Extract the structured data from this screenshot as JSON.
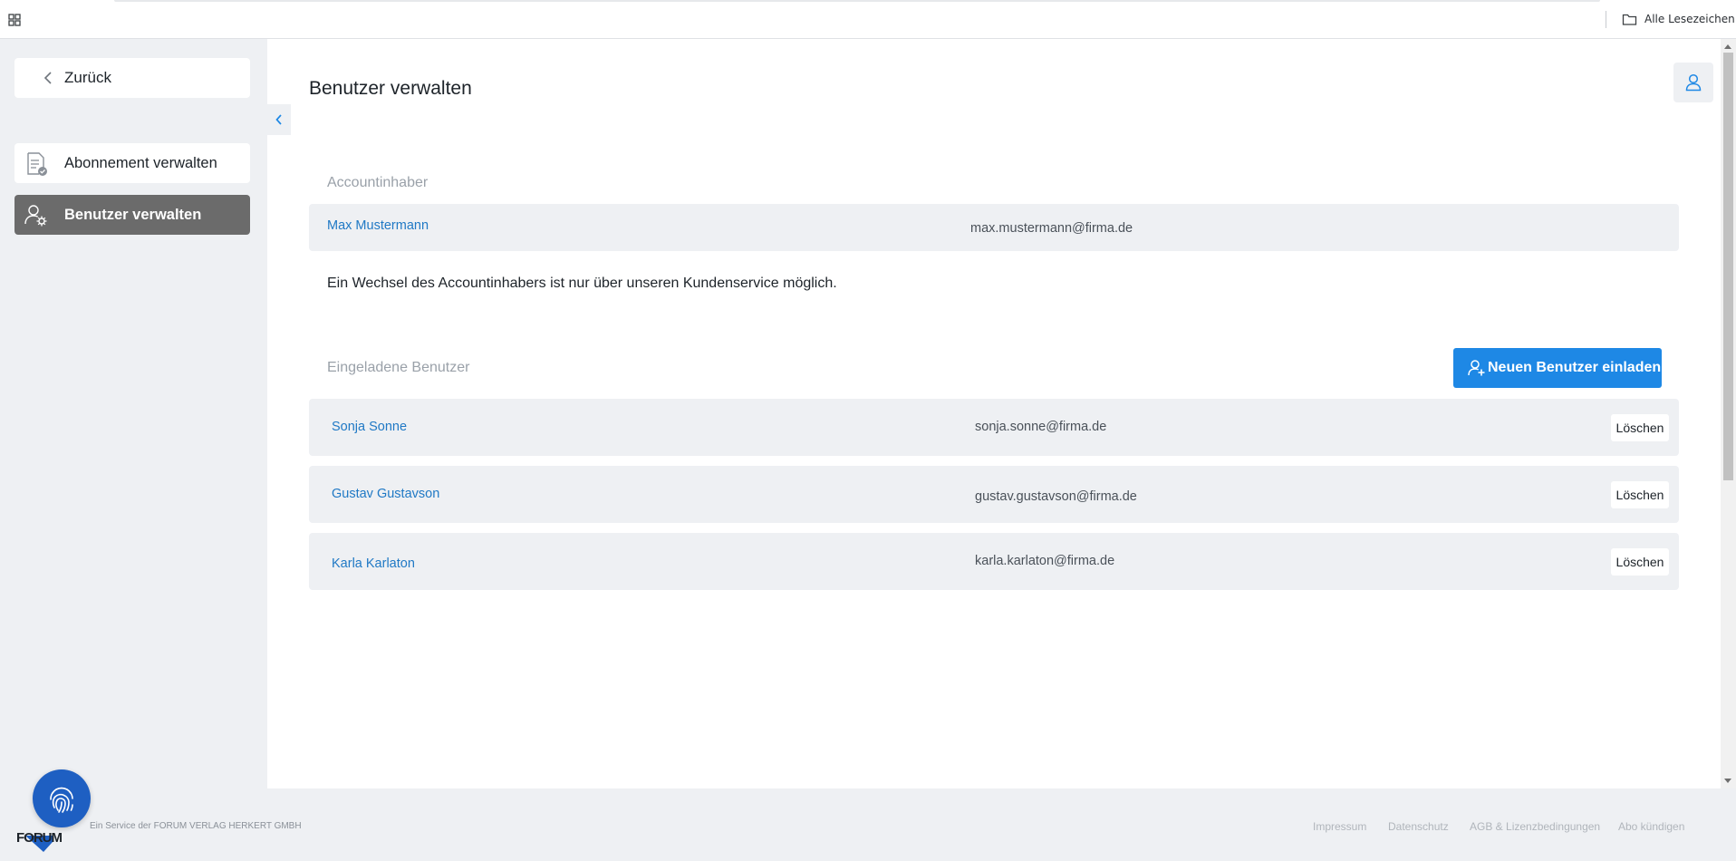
{
  "browser": {
    "bookmarks_label": "Alle Lesezeichen"
  },
  "sidebar": {
    "back_label": "Zurück",
    "items": [
      {
        "label": "Abonnement verwalten",
        "active": false
      },
      {
        "label": "Benutzer verwalten",
        "active": true
      }
    ]
  },
  "main": {
    "title": "Benutzer verwalten",
    "owner_section_label": "Accountinhaber",
    "owner": {
      "name": "Max Mustermann",
      "email": "max.mustermann@firma.de"
    },
    "owner_note": "Ein Wechsel des Accountinhabers ist nur über unseren Kundenservice möglich.",
    "invited_section_label": "Eingeladene Benutzer",
    "invite_button_label": "Neuen Benutzer einladen",
    "delete_label": "Löschen",
    "users": [
      {
        "name": "Sonja Sonne",
        "email": "sonja.sonne@firma.de"
      },
      {
        "name": "Gustav Gustavson",
        "email": "gustav.gustavson@firma.de"
      },
      {
        "name": "Karla Karlaton",
        "email": "karla.karlaton@firma.de"
      }
    ]
  },
  "footer": {
    "service_text": "Ein Service der FORUM VERLAG HERKERT GMBH",
    "links": [
      "Impressum",
      "Datenschutz",
      "AGB & Lizenzbedingungen",
      "Abo kündigen"
    ]
  },
  "colors": {
    "accent": "#1e88e5",
    "link": "#2079c5",
    "active_nav": "#6b6b6b",
    "panel_bg": "#eef0f3"
  }
}
